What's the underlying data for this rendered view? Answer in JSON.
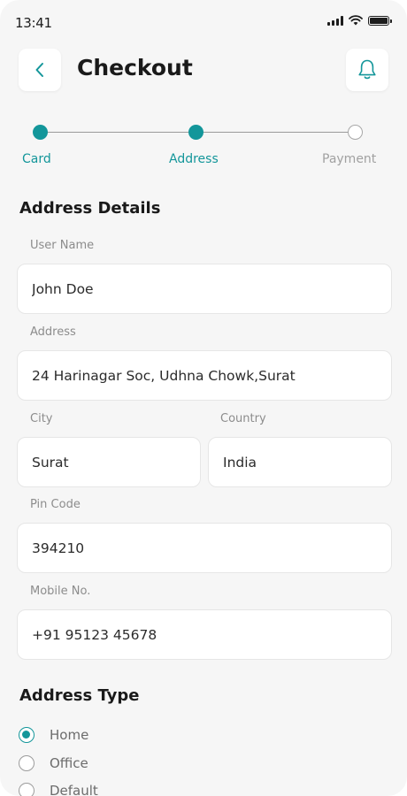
{
  "status_bar": {
    "time": "13:41"
  },
  "header": {
    "title": "Checkout"
  },
  "stepper": {
    "steps": [
      {
        "label": "Card",
        "state": "complete"
      },
      {
        "label": "Address",
        "state": "active"
      },
      {
        "label": "Payment",
        "state": "pending"
      }
    ]
  },
  "address_details": {
    "title": "Address Details",
    "user_name": {
      "label": "User Name",
      "value": "John Doe"
    },
    "address": {
      "label": "Address",
      "value": "24 Harinagar Soc, Udhna Chowk,Surat"
    },
    "city": {
      "label": "City",
      "value": "Surat"
    },
    "country": {
      "label": "Country",
      "value": "India"
    },
    "pin_code": {
      "label": "Pin Code",
      "value": "394210"
    },
    "mobile": {
      "label": "Mobile No.",
      "value": "+91 95123 45678"
    }
  },
  "address_type": {
    "title": "Address Type",
    "options": [
      {
        "label": "Home",
        "selected": true
      },
      {
        "label": "Office",
        "selected": false
      },
      {
        "label": "Default",
        "selected": false
      }
    ]
  },
  "colors": {
    "accent": "#13969a",
    "background": "#f6f6f6",
    "field_bg": "#ffffff"
  },
  "icons": {
    "back": "chevron-left-icon",
    "notifications": "bell-icon"
  }
}
